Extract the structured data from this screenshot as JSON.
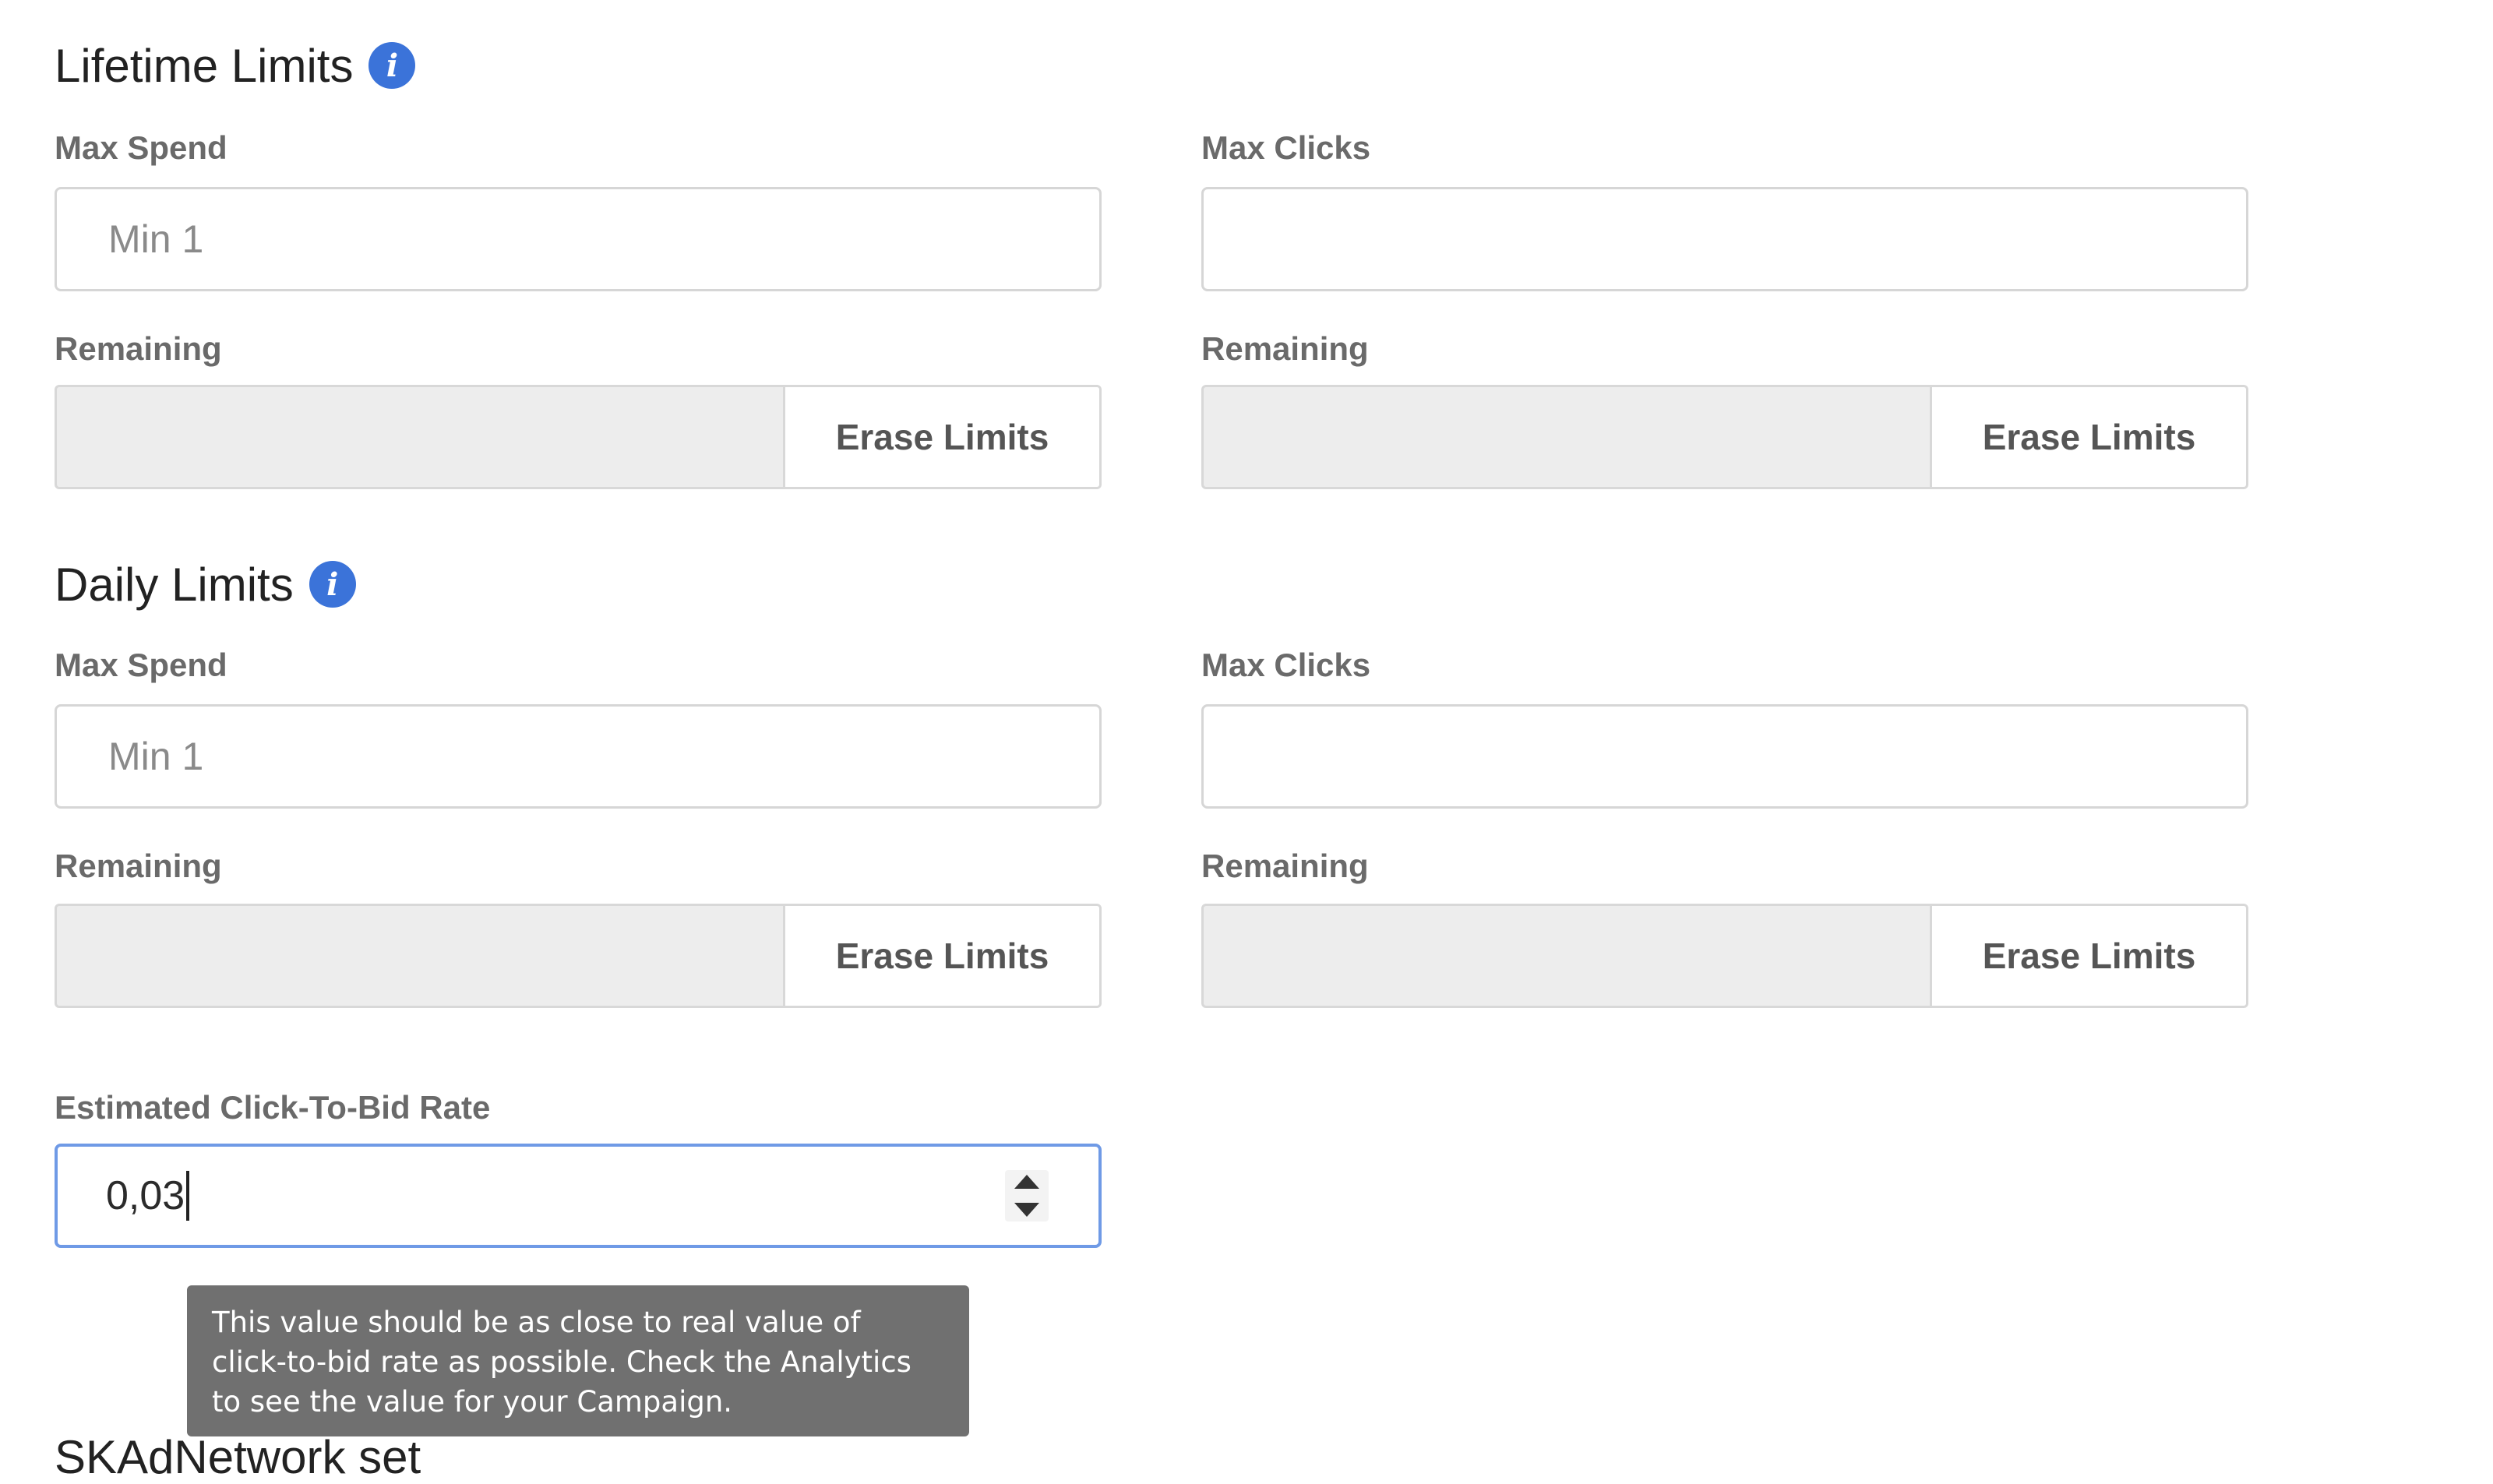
{
  "lifetime": {
    "title": "Lifetime Limits",
    "max_spend_label": "Max Spend",
    "max_spend_placeholder": "Min 1",
    "max_clicks_label": "Max Clicks",
    "remaining_label_left": "Remaining",
    "remaining_label_right": "Remaining",
    "erase_left": "Erase Limits",
    "erase_right": "Erase Limits"
  },
  "daily": {
    "title": "Daily Limits",
    "max_spend_label": "Max Spend",
    "max_spend_placeholder": "Min 1",
    "max_clicks_label": "Max Clicks",
    "remaining_label_left": "Remaining",
    "remaining_label_right": "Remaining",
    "erase_left": "Erase Limits",
    "erase_right": "Erase Limits"
  },
  "rate": {
    "label": "Estimated Click-To-Bid Rate",
    "value": "0,03",
    "tooltip": "This value should be as close to real value of click-to-bid rate as possible. Check the Analytics to see the value for your Campaign."
  },
  "next_section": {
    "title_partial": "SKAdNetwork set"
  },
  "icons": {
    "info": "info-icon"
  },
  "colors": {
    "info_icon": "#3b73d9",
    "focus_border": "#6f9ae6",
    "tooltip_bg": "#707070",
    "readonly_bg": "#ededed"
  }
}
